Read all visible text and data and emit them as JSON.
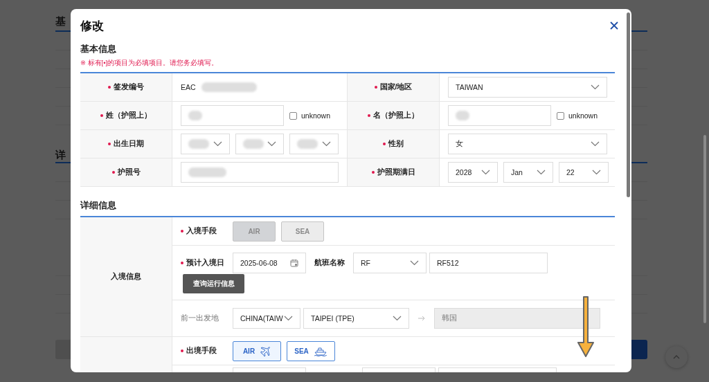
{
  "background": {
    "headings": [
      "基",
      "详"
    ]
  },
  "dialog": {
    "title": "修改",
    "basic": {
      "heading": "基本信息",
      "note": "※ 标有[•]的项目为必填项目。请您务必填写。",
      "rows": [
        {
          "cells": [
            {
              "label": "签发编号",
              "required": true,
              "field": {
                "kind": "static",
                "value": "EAC",
                "redacted": true
              }
            },
            {
              "label": "国家/地区",
              "required": true,
              "field": {
                "kind": "select",
                "value": "TAIWAN"
              }
            }
          ]
        },
        {
          "cells": [
            {
              "label": "姓（护照上）",
              "required": true,
              "field": {
                "kind": "input",
                "redacted": true,
                "unknown": {
                  "label": "unknown",
                  "checked": false
                }
              }
            },
            {
              "label": "名（护照上）",
              "required": true,
              "field": {
                "kind": "input",
                "redacted": true,
                "unknown": {
                  "label": "unknown",
                  "checked": false
                }
              }
            }
          ]
        },
        {
          "cells": [
            {
              "label": "出生日期",
              "required": true,
              "field": {
                "kind": "selects",
                "options": [
                  {
                    "redacted": true
                  },
                  {
                    "redacted": true
                  },
                  {
                    "redacted": true
                  }
                ]
              }
            },
            {
              "label": "性别",
              "required": true,
              "field": {
                "kind": "select",
                "value": "女"
              }
            }
          ]
        },
        {
          "cells": [
            {
              "label": "护照号",
              "required": true,
              "field": {
                "kind": "wide_input",
                "redacted": true
              }
            },
            {
              "label": "护照期满日",
              "required": true,
              "field": {
                "kind": "selects",
                "options": [
                  {
                    "value": "2028"
                  },
                  {
                    "value": "Jan"
                  },
                  {
                    "value": "22"
                  }
                ]
              }
            }
          ]
        }
      ]
    },
    "detail": {
      "heading": "详细信息",
      "groups": [
        {
          "label": "入境信息",
          "rows": [
            {
              "kind": "mode",
              "label": "入境手段",
              "required": true,
              "disabled": true,
              "options": [
                {
                  "label": "AIR",
                  "selected": true
                },
                {
                  "label": "SEA",
                  "selected": false
                }
              ]
            },
            {
              "kind": "arrival",
              "label": "预计入境日",
              "required": true,
              "date": "2025-06-08",
              "flight_label": "航班名称",
              "airline": "RF",
              "flight_no": "RF512",
              "button": "查询运行信息"
            },
            {
              "kind": "departure",
              "label": "前一出发地",
              "required": false,
              "country": "CHINA(TAIW",
              "city": "TAIPEI (TPE)",
              "destination": "韩国"
            }
          ]
        },
        {
          "rows": [
            {
              "kind": "mode",
              "label": "出境手段",
              "required": true,
              "disabled": false,
              "options": [
                {
                  "kind": "air",
                  "label": "AIR",
                  "selected": true
                },
                {
                  "kind": "sea",
                  "label": "SEA",
                  "selected": false
                }
              ]
            },
            {
              "kind": "partial"
            }
          ]
        }
      ]
    }
  }
}
